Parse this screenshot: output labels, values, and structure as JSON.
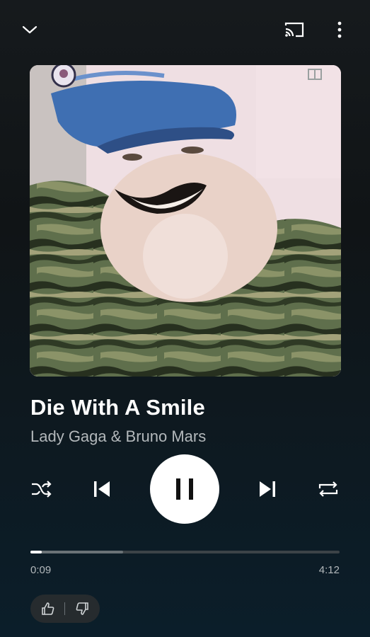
{
  "header": {
    "collapse_icon": "chevron-down-icon",
    "cast_icon": "cast-icon",
    "more_icon": "more-vert-icon"
  },
  "track": {
    "title": "Die With A Smile",
    "artist": "Lady Gaga & Bruno Mars",
    "artwork_alt": "album-artwork"
  },
  "controls": {
    "shuffle_icon": "shuffle-icon",
    "previous_icon": "skip-previous-icon",
    "playpause_icon": "pause-icon",
    "next_icon": "skip-next-icon",
    "repeat_icon": "repeat-icon"
  },
  "progress": {
    "current_time": "0:09",
    "total_time": "4:12",
    "played_fraction": 0.036,
    "buffered_fraction": 0.3
  },
  "rating": {
    "like_icon": "thumb-up-icon",
    "dislike_icon": "thumb-down-icon"
  },
  "colors": {
    "accent": "#ffffff",
    "secondary_text": "#b3b8bb",
    "background_top": "#161a1d",
    "background_bottom": "#0b1e2a"
  }
}
